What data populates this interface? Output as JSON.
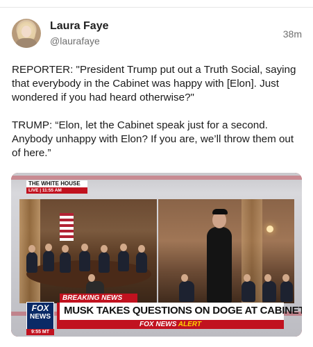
{
  "post": {
    "author_name": "Laura Faye",
    "author_handle": "@laurafaye",
    "timestamp": "38m",
    "paragraphs": [
      "REPORTER: \"President Trump put out a Truth Social, saying that everybody in the Cabinet was happy with [Elon]. Just wondered if you had heard otherwise?\"",
      "TRUMP: “Elon, let the Cabinet speak just for a second. Anybody unhappy with Elon? If you are, we’ll throw them out of here.”"
    ]
  },
  "media": {
    "location_tag": "THE WHITE HOUSE",
    "live_tag": "LIVE | 11:55 AM",
    "breaking_label": "BREAKING NEWS",
    "headline": "MUSK TAKES QUESTIONS ON DOGE AT CABINET MEETING",
    "alert_brand": "FOX NEWS",
    "alert_word": "ALERT",
    "logo_top": "FOX",
    "logo_bottom": "NEWS",
    "clock": "9:55 MT"
  }
}
